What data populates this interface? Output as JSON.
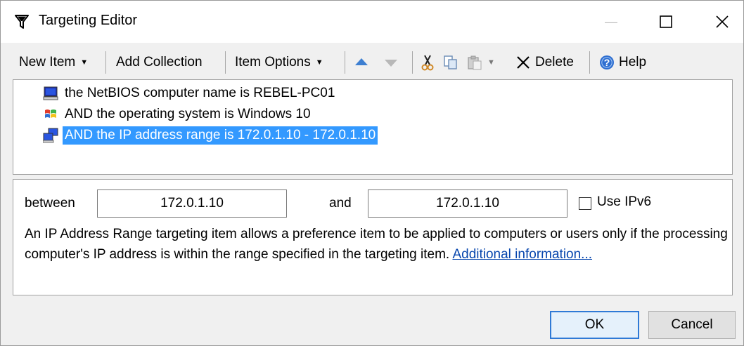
{
  "window": {
    "title": "Targeting Editor"
  },
  "titlebar": {
    "minimize_glyph": "—",
    "maximize_glyph": "☐",
    "close_glyph": "✕"
  },
  "toolbar": {
    "new_item": "New Item",
    "add_collection": "Add Collection",
    "item_options": "Item Options",
    "delete": "Delete",
    "help": "Help"
  },
  "tree": {
    "items": [
      {
        "label": "the NetBIOS computer name is REBEL-PC01",
        "icon": "computer-icon",
        "selected": false
      },
      {
        "label": "AND the operating system is Windows 10",
        "icon": "windows-logo-icon",
        "selected": false
      },
      {
        "label": "AND the IP address range is 172.0.1.10 - 172.0.1.10",
        "icon": "network-computer-icon",
        "selected": true
      }
    ]
  },
  "details": {
    "between_label": "between",
    "from_value": "172.0.1.10",
    "and_label": "and",
    "to_value": "172.0.1.10",
    "use_ipv6_label": "Use IPv6",
    "use_ipv6_checked": false,
    "description": "An IP Address Range targeting item allows a preference item to be applied to computers or users only if the processing computer's IP address is within the range specified in the targeting item.",
    "link_text": "Additional information..."
  },
  "buttons": {
    "ok": "OK",
    "cancel": "Cancel"
  },
  "colors": {
    "selection": "#3399ff",
    "link": "#0645ad",
    "default_button_border": "#2f7ad6"
  }
}
